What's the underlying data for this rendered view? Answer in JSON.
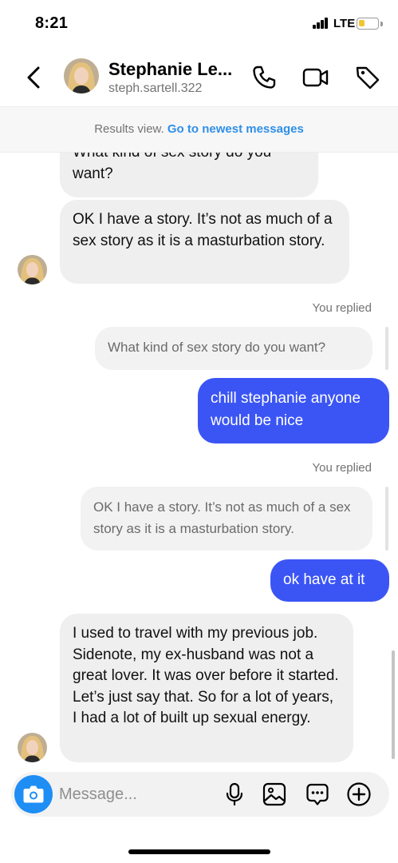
{
  "status_bar": {
    "time": "8:21",
    "network": "LTE",
    "battery_level": 0.35,
    "battery_color": "#f4c430"
  },
  "header": {
    "contact_name": "Stephanie Le...",
    "username": "steph.sartell.322",
    "icons": [
      "chevron-left-icon",
      "phone-icon",
      "video-icon",
      "tag-icon"
    ]
  },
  "banner": {
    "text": "Results view. ",
    "link": "Go to newest messages",
    "link_color": "#2f8fe8"
  },
  "messages": [
    {
      "kind": "incoming",
      "text": "What kind of sex story do you want?"
    },
    {
      "kind": "incoming",
      "text": "OK I have a story. It’s not as much of a sex story as it is a masturbation story."
    },
    {
      "kind": "reply_label",
      "text": "You replied"
    },
    {
      "kind": "quoted",
      "text": "What kind of sex story do you want?"
    },
    {
      "kind": "outgoing",
      "text": "chill stephanie anyone would be nice"
    },
    {
      "kind": "reply_label",
      "text": "You replied"
    },
    {
      "kind": "quoted",
      "text": "OK I have a story. It’s not as much of a sex story as it is a masturbation story."
    },
    {
      "kind": "outgoing",
      "text": "ok have at it"
    },
    {
      "kind": "incoming",
      "text": "I used to travel with my previous job. Sidenote, my ex-husband was not a great lover. It was over before it started. Let’s just say that. So for a lot of years, I had a lot of built up sexual energy."
    }
  ],
  "composer": {
    "placeholder": "Message...",
    "icons": [
      "camera-icon",
      "microphone-icon",
      "image-icon",
      "chat-icon",
      "plus-circle-icon"
    ]
  },
  "colors": {
    "outgoing_bubble": "#3b55f5",
    "incoming_bubble": "#efefef",
    "camera_button": "#1e8ef5"
  }
}
